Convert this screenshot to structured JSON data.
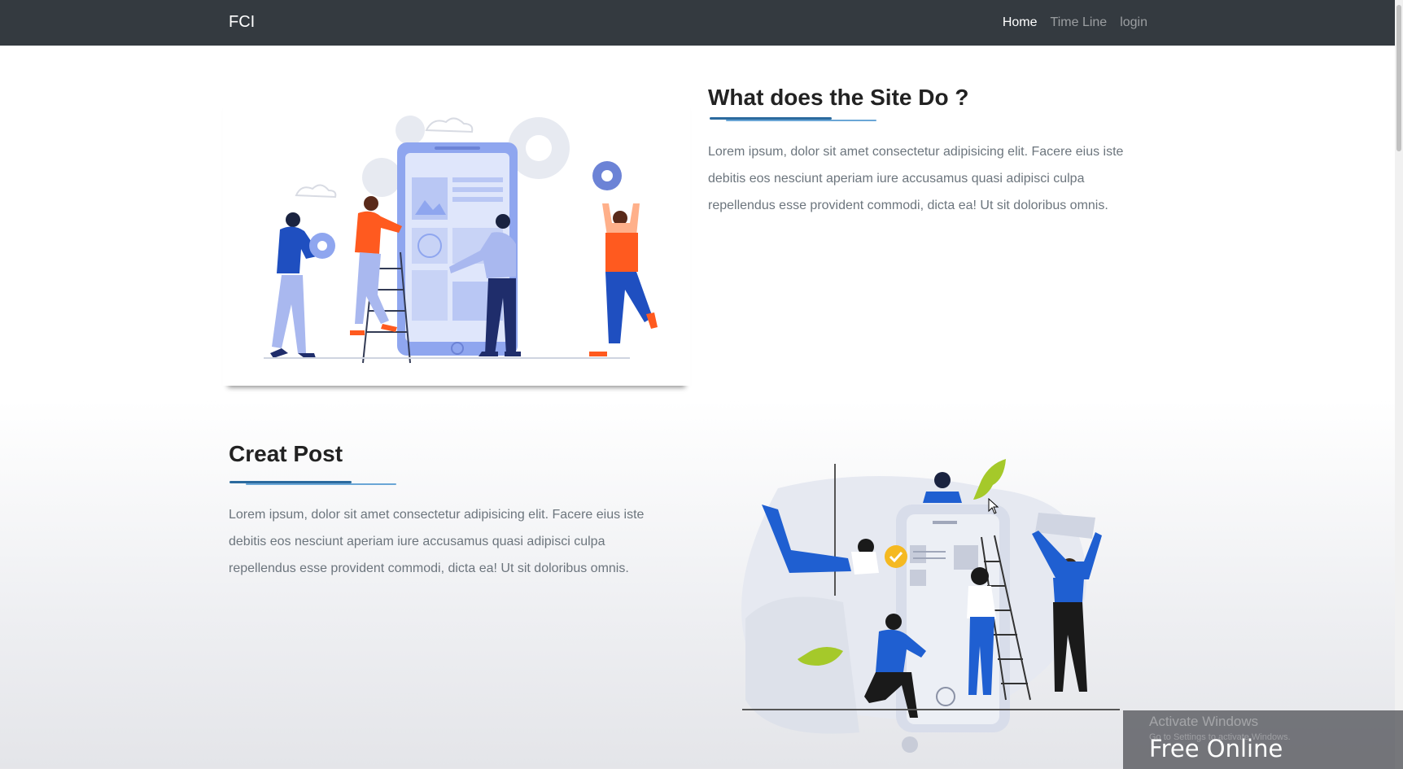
{
  "navbar": {
    "brand": "FCI",
    "links": [
      {
        "label": "Home",
        "active": true
      },
      {
        "label": "Time Line",
        "active": false
      },
      {
        "label": "login",
        "active": false
      }
    ],
    "background": "#343a40"
  },
  "section_about": {
    "heading": "What does the Site Do ?",
    "text": "Lorem ipsum, dolor sit amet consectetur adipisicing elit. Facere eius iste debitis eos nesciunt aperiam iure accusamus quasi adipisci culpa repellendus esse provident commodi, dicta ea! Ut sit doloribus omnis.",
    "illustration": "team-building-app-illustration"
  },
  "section_post": {
    "heading": "Creat Post",
    "text": "Lorem ipsum, dolor sit amet consectetur adipisicing elit. Facere eius iste debitis eos nesciunt aperiam iure accusamus quasi adipisci culpa repellendus esse provident commodi, dicta ea! Ut sit doloribus omnis.",
    "illustration": "team-creating-post-illustration"
  },
  "overlay": {
    "activate_title": "Activate Windows",
    "activate_sub": "Go to Settings to activate Windows.",
    "watermark": "Free Online"
  },
  "colors": {
    "accent_blue": "#2b6a9e",
    "person_blue": "#1f4fc0",
    "person_orange": "#ff5a1f",
    "phone_blue": "#8fa6ef"
  }
}
